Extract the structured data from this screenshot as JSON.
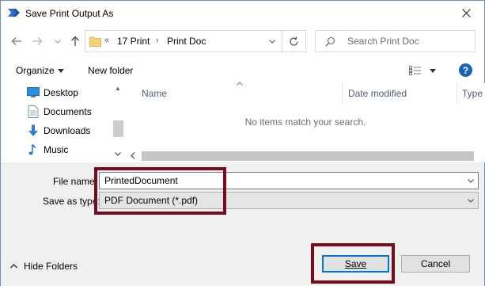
{
  "window": {
    "title": "Save Print Output As",
    "close_label": "✕"
  },
  "nav": {
    "back_icon": "arrow-left-icon",
    "forward_icon": "arrow-right-icon",
    "recent_icon": "chevron-down-icon",
    "up_icon": "arrow-up-icon",
    "breadcrumb_overflow": "«",
    "breadcrumb": [
      "17 Print",
      "Print Doc"
    ],
    "search_placeholder": "Search Print Doc"
  },
  "toolbar": {
    "organize_label": "Organize",
    "new_folder_label": "New folder",
    "help_label": "?"
  },
  "sidebar": {
    "items": [
      {
        "label": "Desktop",
        "icon": "desktop-icon"
      },
      {
        "label": "Documents",
        "icon": "documents-icon"
      },
      {
        "label": "Downloads",
        "icon": "downloads-icon"
      },
      {
        "label": "Music",
        "icon": "music-icon"
      }
    ]
  },
  "filelist": {
    "columns": [
      "Name",
      "Date modified",
      "Type"
    ],
    "empty_message": "No items match your search."
  },
  "form": {
    "file_name_label": "File name:",
    "file_name_value": "PrintedDocument",
    "save_as_type_label": "Save as type:",
    "save_as_type_value": "PDF Document (*.pdf)"
  },
  "footer": {
    "hide_folders_label": "Hide Folders",
    "save_label": "Save",
    "cancel_label": "Cancel"
  },
  "colors": {
    "accent": "#0078d7",
    "highlight": "#7a0b1f",
    "help": "#1b63b5"
  }
}
